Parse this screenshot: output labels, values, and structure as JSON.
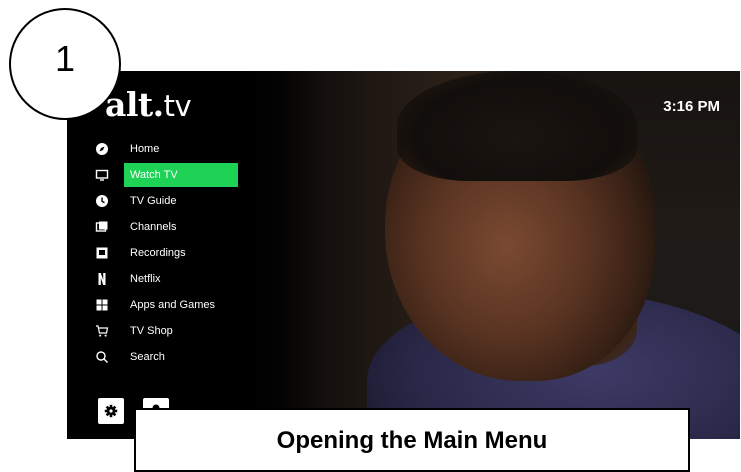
{
  "step": {
    "number": "1"
  },
  "caption": {
    "text": "Opening the Main Menu"
  },
  "header": {
    "logo_main": "alt.",
    "logo_suffix": "tv",
    "clock": "3:16 PM"
  },
  "menu": {
    "items": [
      {
        "label": "Home",
        "icon": "compass-icon",
        "active": false
      },
      {
        "label": "Watch TV",
        "icon": "tv-icon",
        "active": true
      },
      {
        "label": "TV Guide",
        "icon": "clock-icon",
        "active": false
      },
      {
        "label": "Channels",
        "icon": "channels-icon",
        "active": false
      },
      {
        "label": "Recordings",
        "icon": "recordings-icon",
        "active": false
      },
      {
        "label": "Netflix",
        "icon": "netflix-icon",
        "active": false
      },
      {
        "label": "Apps and Games",
        "icon": "apps-grid-icon",
        "active": false
      },
      {
        "label": "TV Shop",
        "icon": "cart-icon",
        "active": false
      },
      {
        "label": "Search",
        "icon": "search-icon",
        "active": false
      }
    ]
  },
  "footer_buttons": {
    "settings_icon": "gear-icon",
    "profile_icon": "profile-icon"
  },
  "colors": {
    "accent": "#1ed255",
    "menu_background": "#000000",
    "text": "#ffffff"
  }
}
